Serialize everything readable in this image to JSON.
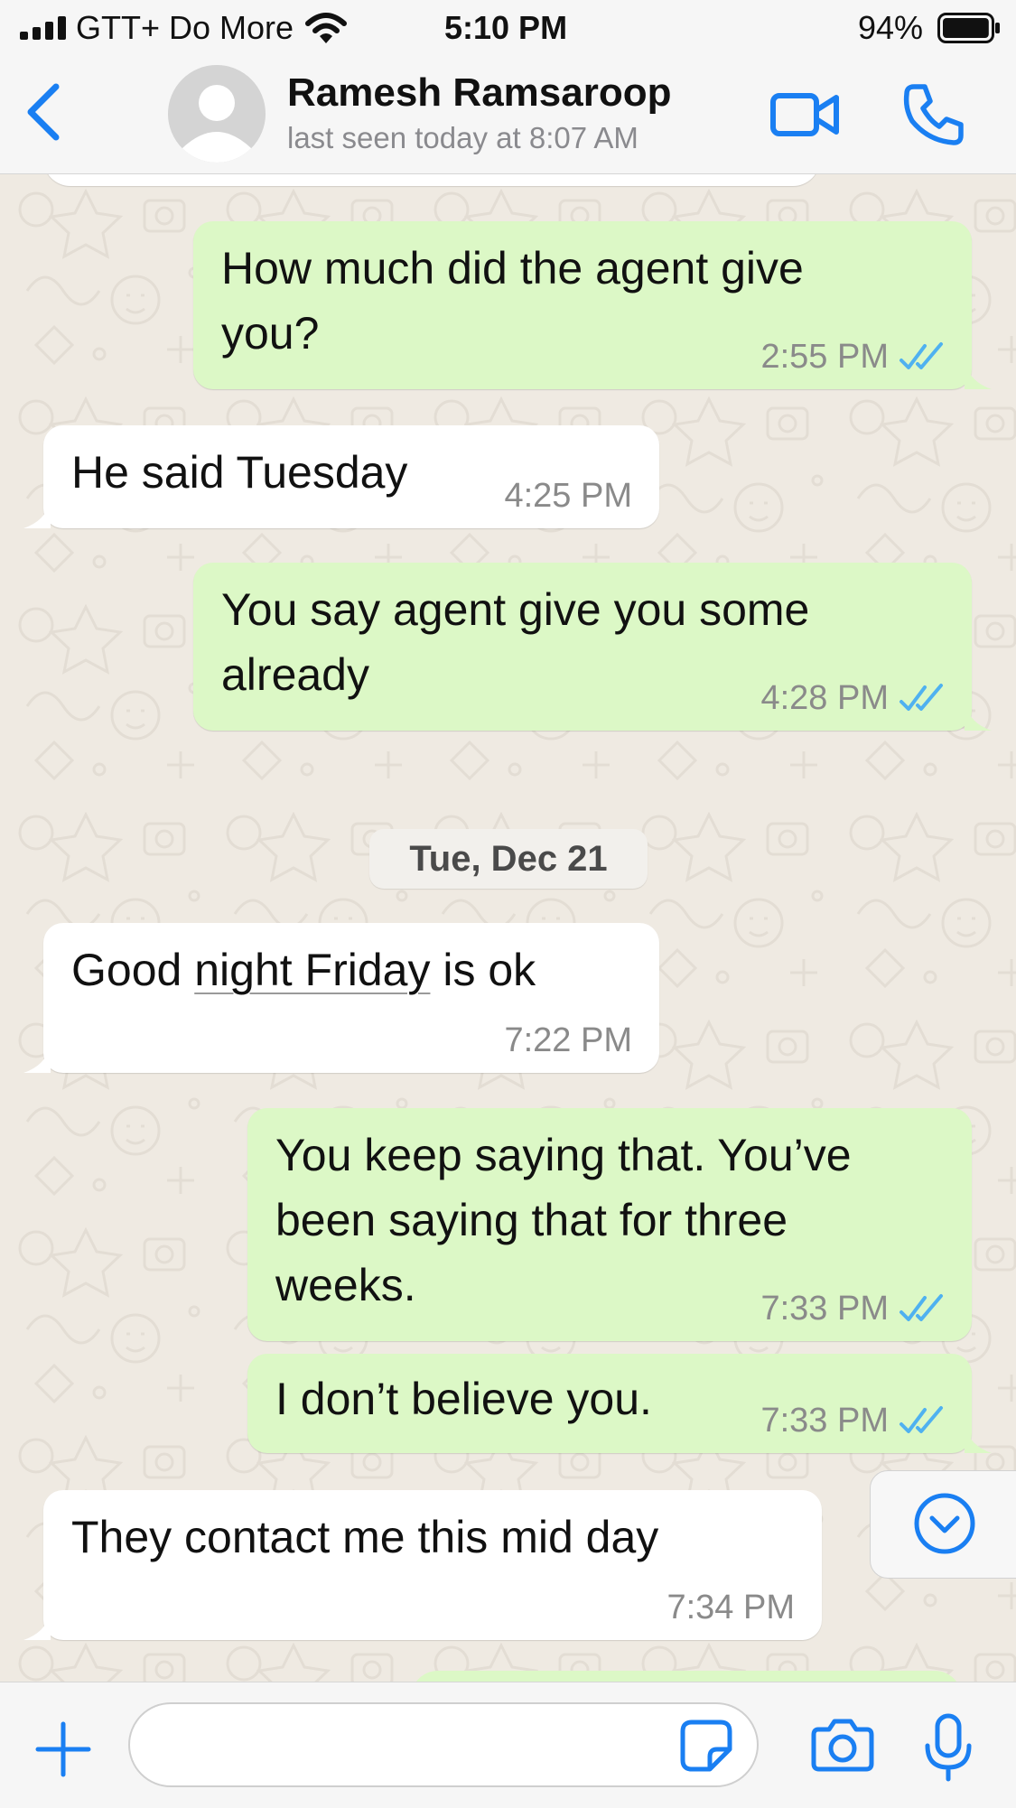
{
  "status_bar": {
    "carrier": "GTT+ Do More",
    "time": "5:10 PM",
    "battery_percent": "94%",
    "battery_level": 0.94,
    "signal_bars": 4
  },
  "header": {
    "contact_name": "Ramesh Ramsaroop",
    "last_seen": "last seen today at 8:07 AM",
    "back_icon": "chevron-left-icon",
    "video_icon": "video-camera-icon",
    "phone_icon": "phone-icon"
  },
  "messages": [
    {
      "direction": "outgoing",
      "text_lines": [
        "How much did the agent give",
        "you?"
      ],
      "time": "2:55 PM",
      "read": true
    },
    {
      "direction": "incoming",
      "text_lines": [
        "He said Tuesday"
      ],
      "time": "4:25 PM"
    },
    {
      "direction": "outgoing",
      "text_lines": [
        "You say agent give you some",
        "already"
      ],
      "time": "4:28 PM",
      "read": true
    },
    {
      "direction": "incoming",
      "text_parts": [
        "Good ",
        "night Friday",
        " is ok"
      ],
      "time": "7:22 PM"
    },
    {
      "direction": "outgoing",
      "text_lines": [
        "You keep saying that. You’ve",
        "been saying that for three",
        "weeks."
      ],
      "time": "7:33 PM",
      "read": true
    },
    {
      "direction": "outgoing",
      "text_lines": [
        "I don’t believe you."
      ],
      "time": "7:33 PM",
      "read": true
    },
    {
      "direction": "incoming",
      "text_lines": [
        "They contact me this mid day"
      ],
      "time": "7:34 PM"
    }
  ],
  "date_separator": "Tue, Dec 21",
  "input_bar": {
    "placeholder": "",
    "attach_icon": "plus-icon",
    "sticker_icon": "sticker-icon",
    "camera_icon": "camera-icon",
    "mic_icon": "microphone-icon"
  },
  "colors": {
    "accent": "#1a7ff2",
    "outgoing_bubble": "#dcf8c6",
    "incoming_bubble": "#ffffff",
    "read_ticks": "#4fb1f0",
    "chat_background": "#efeae2"
  }
}
